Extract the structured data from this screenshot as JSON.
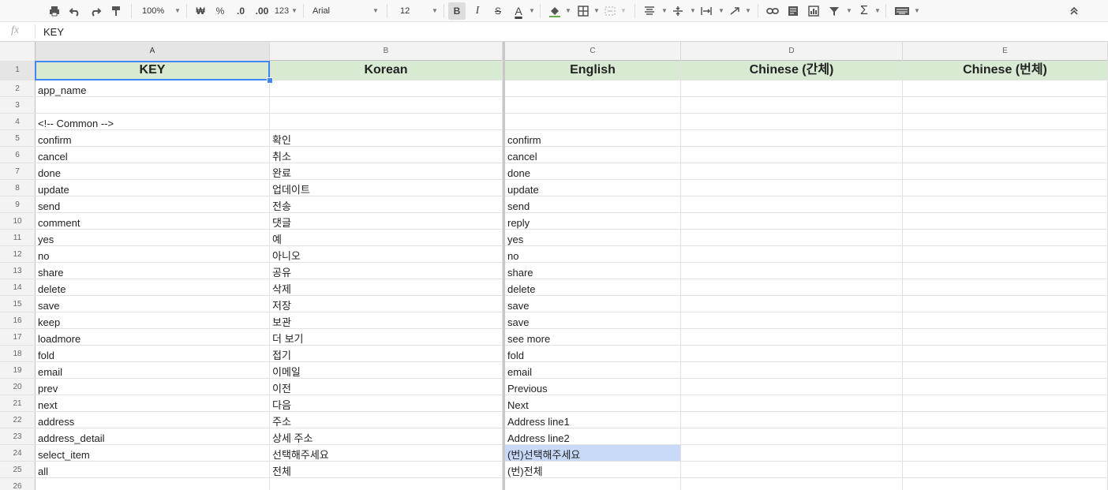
{
  "toolbar": {
    "zoom": "100%",
    "currency": "₩",
    "percent": "%",
    "decimal_decrease": ".0",
    "decimal_increase": ".00",
    "number_format": "123",
    "font": "Arial",
    "font_size": "12",
    "bold": "B",
    "italic": "I",
    "strike": "S",
    "text_color": "A",
    "functions": "Σ"
  },
  "formula_bar": {
    "fx_label": "fx",
    "value": "KEY"
  },
  "columns": [
    "A",
    "B",
    "C",
    "D",
    "E"
  ],
  "header_row": {
    "number": "1",
    "cells": [
      "KEY",
      "Korean",
      "English",
      "Chinese (간체)",
      "Chinese (번체)"
    ]
  },
  "rows": [
    {
      "n": "2",
      "a": "app_name",
      "b": "",
      "c": ""
    },
    {
      "n": "3",
      "a": "",
      "b": "",
      "c": ""
    },
    {
      "n": "4",
      "a": "<!-- Common -->",
      "b": "",
      "c": ""
    },
    {
      "n": "5",
      "a": "confirm",
      "b": "확인",
      "c": "confirm"
    },
    {
      "n": "6",
      "a": "cancel",
      "b": "취소",
      "c": "cancel"
    },
    {
      "n": "7",
      "a": "done",
      "b": "완료",
      "c": "done"
    },
    {
      "n": "8",
      "a": "update",
      "b": "업데이트",
      "c": "update"
    },
    {
      "n": "9",
      "a": "send",
      "b": "전송",
      "c": "send"
    },
    {
      "n": "10",
      "a": "comment",
      "b": "댓글",
      "c": "reply"
    },
    {
      "n": "11",
      "a": "yes",
      "b": "예",
      "c": "yes"
    },
    {
      "n": "12",
      "a": "no",
      "b": "아니오",
      "c": "no"
    },
    {
      "n": "13",
      "a": "share",
      "b": "공유",
      "c": "share"
    },
    {
      "n": "14",
      "a": "delete",
      "b": "삭제",
      "c": "delete"
    },
    {
      "n": "15",
      "a": "save",
      "b": "저장",
      "c": "save"
    },
    {
      "n": "16",
      "a": "keep",
      "b": "보관",
      "c": "save"
    },
    {
      "n": "17",
      "a": "loadmore",
      "b": "더 보기",
      "c": "see more"
    },
    {
      "n": "18",
      "a": "fold",
      "b": "접기",
      "c": "fold"
    },
    {
      "n": "19",
      "a": "email",
      "b": "이메일",
      "c": "email"
    },
    {
      "n": "20",
      "a": "prev",
      "b": "이전",
      "c": "Previous"
    },
    {
      "n": "21",
      "a": "next",
      "b": "다음",
      "c": "Next"
    },
    {
      "n": "22",
      "a": "address",
      "b": "주소",
      "c": "Address line1"
    },
    {
      "n": "23",
      "a": "address_detail",
      "b": "상세 주소",
      "c": "Address line2"
    },
    {
      "n": "24",
      "a": "select_item",
      "b": "선택해주세요",
      "c": "(번)선택해주세요",
      "c_highlight": true
    },
    {
      "n": "25",
      "a": "all",
      "b": "전체",
      "c": "(번)전체"
    },
    {
      "n": "26",
      "a": "",
      "b": "",
      "c": ""
    }
  ],
  "colors": {
    "header_fill": "#d9ead3",
    "selection": "#4285f4",
    "highlight_fill": "#c9daf8"
  }
}
